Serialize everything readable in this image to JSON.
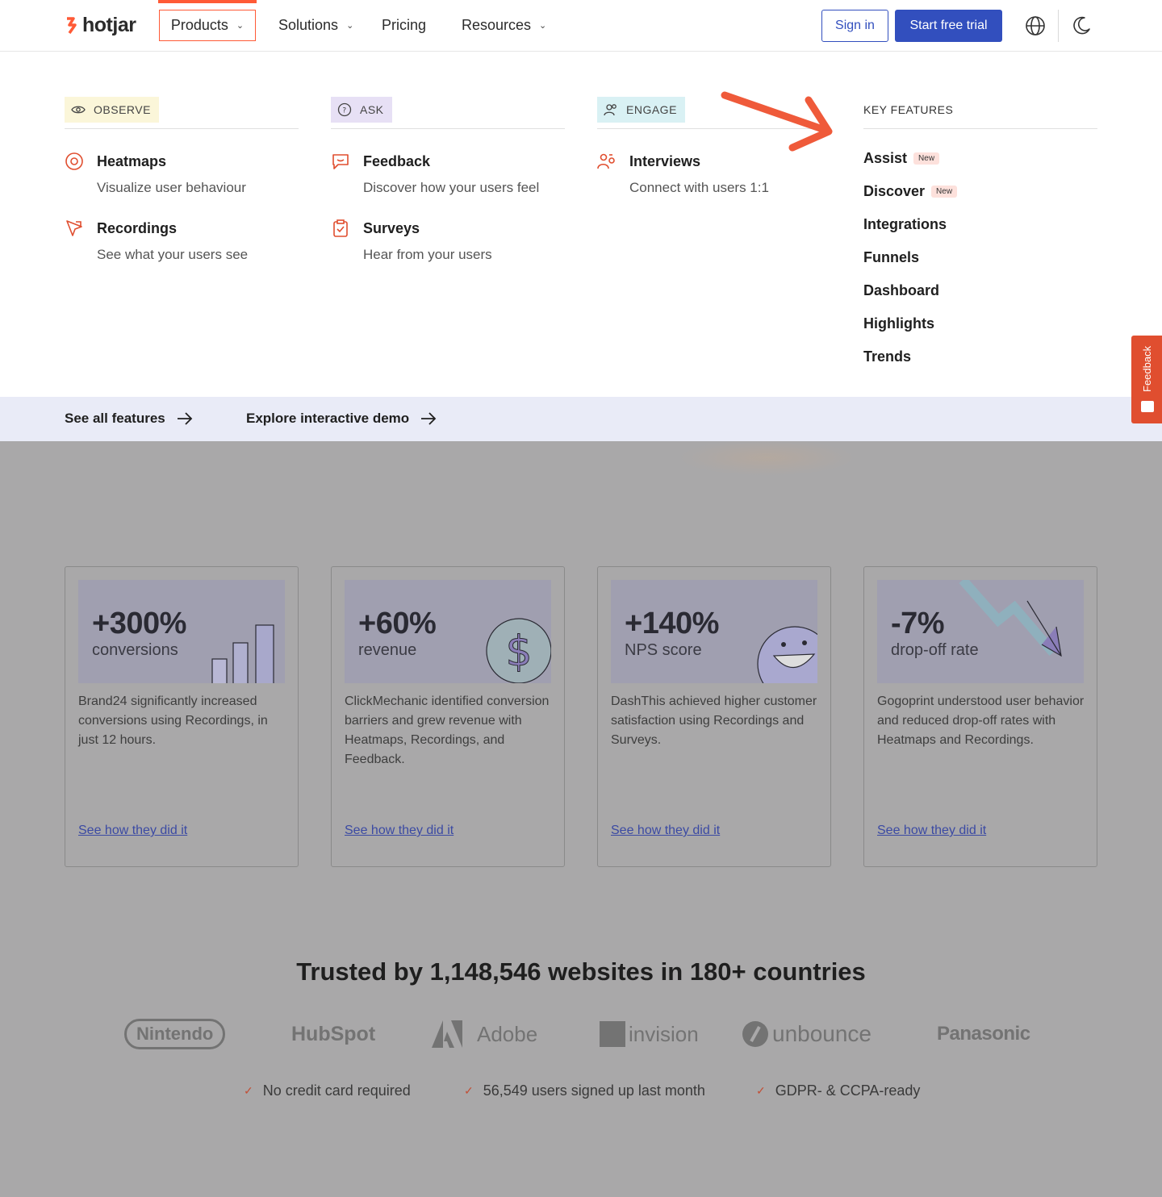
{
  "header": {
    "logo_text": "hotjar",
    "nav": {
      "products": "Products",
      "solutions": "Solutions",
      "pricing": "Pricing",
      "resources": "Resources"
    },
    "sign_in": "Sign in",
    "start_trial": "Start free trial"
  },
  "menu": {
    "observe": {
      "label": "OBSERVE",
      "items": [
        {
          "title": "Heatmaps",
          "desc": "Visualize user behaviour",
          "icon": "heatmap-icon"
        },
        {
          "title": "Recordings",
          "desc": "See what your users see",
          "icon": "recordings-icon"
        }
      ]
    },
    "ask": {
      "label": "ASK",
      "items": [
        {
          "title": "Feedback",
          "desc": "Discover how your users feel",
          "icon": "feedback-icon"
        },
        {
          "title": "Surveys",
          "desc": "Hear from your users",
          "icon": "surveys-icon"
        }
      ]
    },
    "engage": {
      "label": "ENGAGE",
      "items": [
        {
          "title": "Interviews",
          "desc": "Connect with users 1:1",
          "icon": "interviews-icon"
        }
      ]
    },
    "key_features": {
      "label": "KEY FEATURES",
      "items": [
        {
          "title": "Assist",
          "badge": "New"
        },
        {
          "title": "Discover",
          "badge": "New"
        },
        {
          "title": "Integrations"
        },
        {
          "title": "Funnels"
        },
        {
          "title": "Dashboard"
        },
        {
          "title": "Highlights"
        },
        {
          "title": "Trends"
        }
      ]
    },
    "footer": {
      "see_all": "See all features",
      "demo": "Explore interactive demo"
    }
  },
  "feedback_tab": "Feedback",
  "cards": [
    {
      "big": "+300%",
      "sub": "conversions",
      "desc": "Brand24 significantly increased conversions using Recordings, in just 12 hours.",
      "link": "See how they did it"
    },
    {
      "big": "+60%",
      "sub": "revenue",
      "desc": "ClickMechanic identified conversion barriers and grew revenue with Heatmaps, Recordings, and Feedback.",
      "link": "See how they did it"
    },
    {
      "big": "+140%",
      "sub": "NPS score",
      "desc": "DashThis achieved higher customer satisfaction using Recordings and Surveys.",
      "link": "See how they did it"
    },
    {
      "big": "-7%",
      "sub": "drop-off rate",
      "desc": "Gogoprint understood user behavior and reduced drop-off rates with Heatmaps and Recordings.",
      "link": "See how they did it"
    }
  ],
  "trusted": "Trusted by 1,148,546 websites in 180+ countries",
  "logos": {
    "nintendo": "Nintendo",
    "hubspot": "HubSpot",
    "adobe": "Adobe",
    "invision": "invision",
    "unbounce": "unbounce",
    "panasonic": "Panasonic"
  },
  "checks": [
    "No credit card required",
    "56,549 users signed up last month",
    "GDPR- & CCPA-ready"
  ],
  "colors": {
    "brand": "#ff5a36",
    "primary": "#324fbe",
    "overlay": "#a9a8a9"
  }
}
